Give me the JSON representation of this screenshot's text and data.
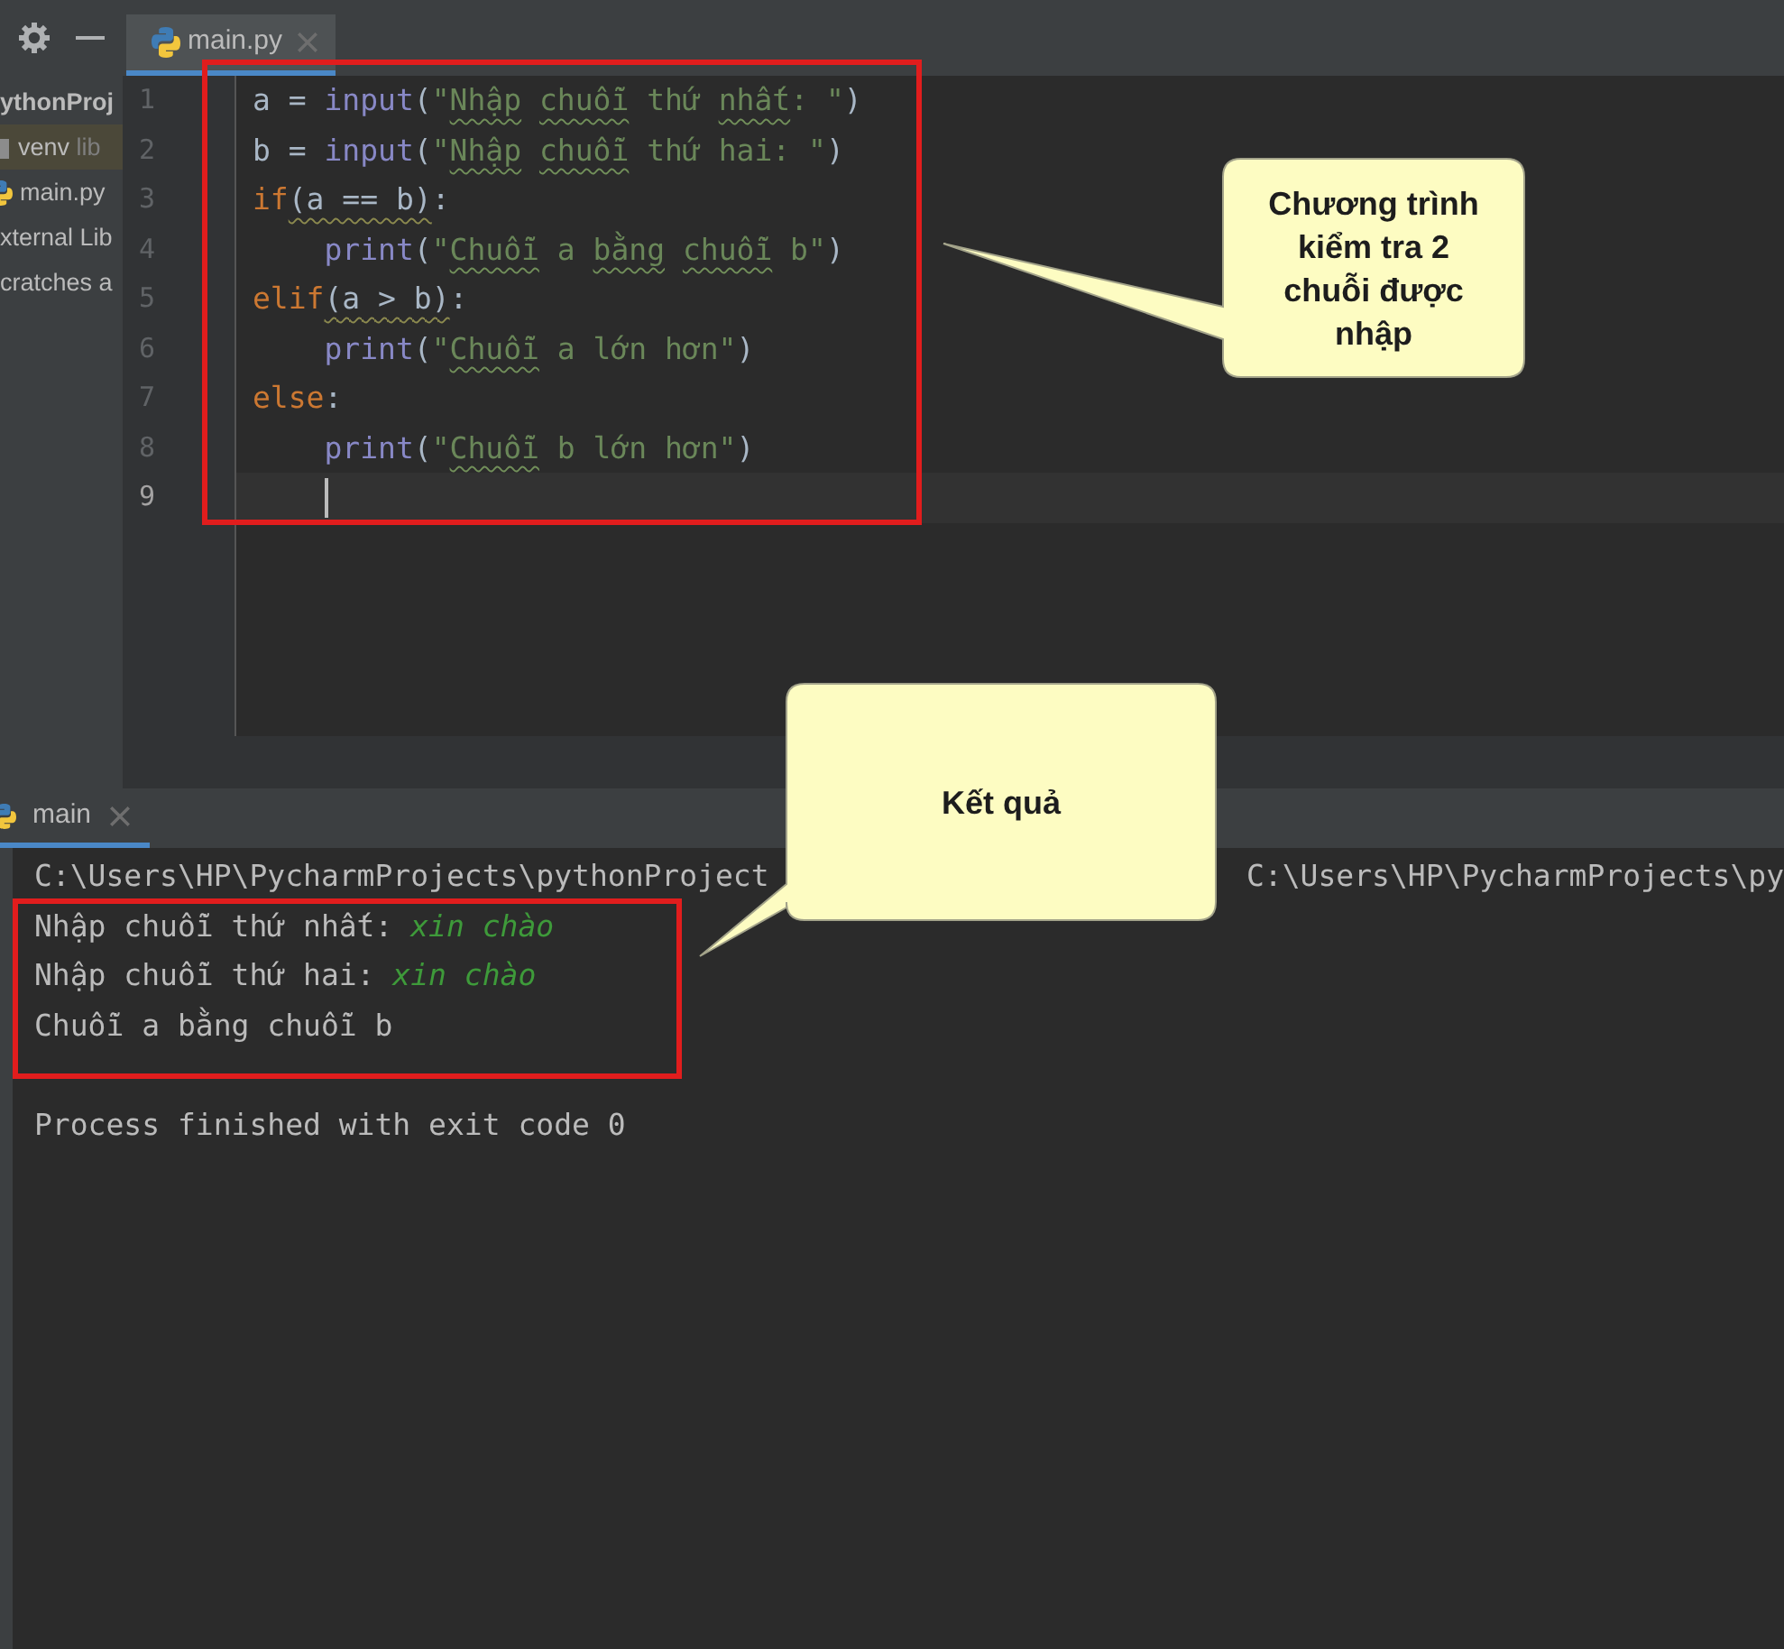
{
  "project_panel": {
    "items": [
      {
        "kind": "project",
        "label": "ythonProj"
      },
      {
        "kind": "library",
        "label": "venv",
        "note": "lib"
      },
      {
        "kind": "file",
        "label": "main.py"
      },
      {
        "kind": "plain",
        "label": "xternal Lib"
      },
      {
        "kind": "plain",
        "label": "cratches a"
      }
    ]
  },
  "editor": {
    "tabs": [
      {
        "label": "main.py",
        "selected": true
      }
    ],
    "lines": [
      {
        "number": "1",
        "current": false,
        "tokens": [
          {
            "text": "a = ",
            "kind": "plain"
          },
          {
            "text": "input",
            "kind": "builtin"
          },
          {
            "text": "(",
            "kind": "plain"
          },
          {
            "text": "\"",
            "kind": "string"
          },
          {
            "text": "Nhập chuỗi",
            "kind": "typo"
          },
          {
            "text": " thứ ",
            "kind": "string"
          },
          {
            "text": "nhất",
            "kind": "typo"
          },
          {
            "text": ": \"",
            "kind": "string"
          },
          {
            "text": ")",
            "kind": "plain"
          }
        ]
      },
      {
        "number": "2",
        "current": false,
        "tokens": [
          {
            "text": "b = ",
            "kind": "plain"
          },
          {
            "text": "input",
            "kind": "builtin"
          },
          {
            "text": "(",
            "kind": "plain"
          },
          {
            "text": "\"",
            "kind": "string"
          },
          {
            "text": "Nhập chuỗi",
            "kind": "typo"
          },
          {
            "text": " thứ hai: \"",
            "kind": "string"
          },
          {
            "text": ")",
            "kind": "plain"
          }
        ]
      },
      {
        "number": "3",
        "current": false,
        "tokens": [
          {
            "text": "if",
            "kind": "keyword"
          },
          {
            "text": "(a == b)",
            "kind": "warning"
          },
          {
            "text": ":",
            "kind": "plain"
          }
        ],
        "children": [
          {
            "number": "4",
            "current": false,
            "tokens": [
              {
                "text": "print",
                "kind": "builtin"
              },
              {
                "text": "(",
                "kind": "plain"
              },
              {
                "text": "\"",
                "kind": "string"
              },
              {
                "text": "Chuỗi",
                "kind": "typo"
              },
              {
                "text": " a ",
                "kind": "string"
              },
              {
                "text": "bằng chuỗi",
                "kind": "typo"
              },
              {
                "text": " b\"",
                "kind": "string"
              },
              {
                "text": ")",
                "kind": "plain"
              }
            ]
          }
        ]
      },
      {
        "number": "5",
        "current": false,
        "tokens": [
          {
            "text": "elif",
            "kind": "keyword"
          },
          {
            "text": "(a > b)",
            "kind": "warning"
          },
          {
            "text": ":",
            "kind": "plain"
          }
        ],
        "children": [
          {
            "number": "6",
            "current": false,
            "tokens": [
              {
                "text": "print",
                "kind": "builtin"
              },
              {
                "text": "(",
                "kind": "plain"
              },
              {
                "text": "\"",
                "kind": "string"
              },
              {
                "text": "Chuỗi",
                "kind": "typo"
              },
              {
                "text": " a lớn hơn\"",
                "kind": "string"
              },
              {
                "text": ")",
                "kind": "plain"
              }
            ]
          }
        ]
      },
      {
        "number": "7",
        "current": false,
        "tokens": [
          {
            "text": "else",
            "kind": "keyword"
          },
          {
            "text": ":",
            "kind": "plain"
          }
        ],
        "children": [
          {
            "number": "8",
            "current": false,
            "tokens": [
              {
                "text": "print",
                "kind": "builtin"
              },
              {
                "text": "(",
                "kind": "plain"
              },
              {
                "text": "\"",
                "kind": "string"
              },
              {
                "text": "Chuỗi",
                "kind": "typo"
              },
              {
                "text": " b lớn hơn\"",
                "kind": "string"
              },
              {
                "text": ")",
                "kind": "plain"
              }
            ]
          },
          {
            "number": "9",
            "current": true
          }
        ]
      }
    ]
  },
  "run_panel": {
    "tabs": [
      {
        "label": "main",
        "selected": true
      }
    ],
    "console": [
      {
        "kind": "command",
        "parts": [
          "C:\\Users\\HP\\PycharmProjects\\pythonProject",
          "C:\\Users\\HP\\PycharmProjects\\py"
        ]
      },
      {
        "kind": "prompt",
        "text": "Nhập chuỗi thứ nhất:",
        "input": "xin chào"
      },
      {
        "kind": "prompt",
        "text": "Nhập chuỗi thứ hai:",
        "input": "xin chào"
      },
      {
        "kind": "output",
        "text": "Chuỗi a bằng chuỗi b"
      },
      {
        "kind": "status",
        "text": "Process finished with exit code 0"
      }
    ]
  },
  "callouts": [
    {
      "text": "Chương trình kiểm tra 2 chuỗi được nhập"
    },
    {
      "text": "Kết quả"
    }
  ]
}
